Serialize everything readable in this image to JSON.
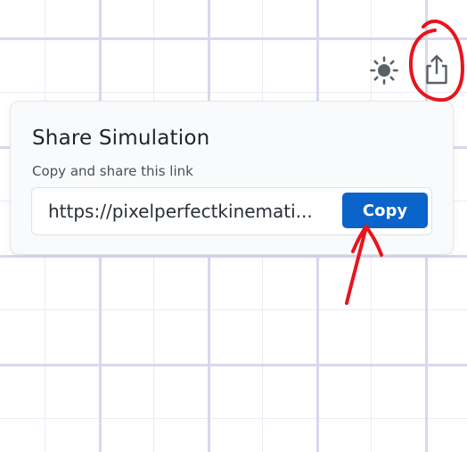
{
  "toolbar": {
    "theme_icon": "sun-icon",
    "share_icon": "share-icon"
  },
  "share_popover": {
    "title": "Share Simulation",
    "subtitle": "Copy and share this link",
    "link_value": "https://pixelperfectkinemati...",
    "copy_label": "Copy"
  },
  "colors": {
    "accent": "#0a64c9",
    "annotation": "#e8141c",
    "grid_major": "#d9d8ee",
    "grid_minor": "#ecebf7"
  }
}
